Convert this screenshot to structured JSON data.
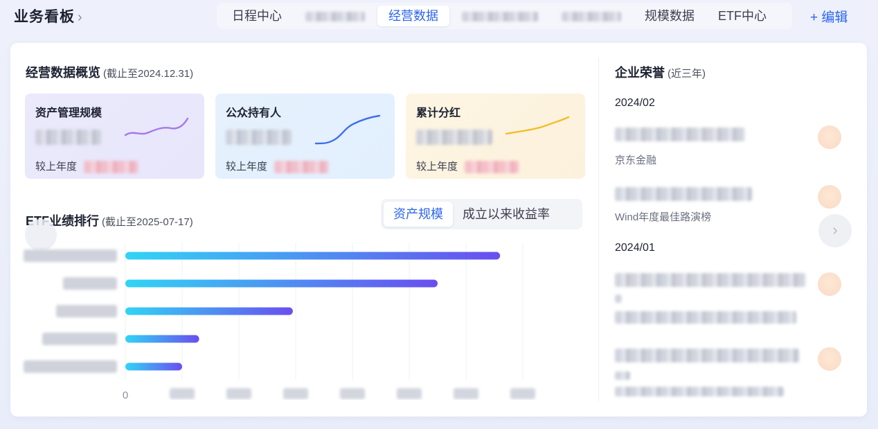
{
  "header": {
    "title": "业务看板",
    "title_chevron": "›",
    "tabs": [
      {
        "label": "日程中心",
        "active": false
      },
      {
        "label": "",
        "active": false
      },
      {
        "label": "经营数据",
        "active": true
      },
      {
        "label": "",
        "active": false
      },
      {
        "label": "",
        "active": false
      },
      {
        "label": "规模数据",
        "active": false
      },
      {
        "label": "ETF中心",
        "active": false
      }
    ],
    "edit_label": "+ 编辑"
  },
  "overview": {
    "title": "经营数据概览",
    "subtitle": "(截止至2024.12.31)",
    "cards": [
      {
        "label": "资产管理规模",
        "compare_label": "较上年度",
        "color": "#9b6fe6"
      },
      {
        "label": "公众持有人",
        "compare_label": "较上年度",
        "color": "#3f6fe8"
      },
      {
        "label": "累计分红",
        "compare_label": "较上年度",
        "color": "#f0bf2a"
      }
    ]
  },
  "etf_ranking": {
    "title": "ETF业绩排行",
    "subtitle": "(截止至2025-07-17)",
    "segments": [
      {
        "label": "资产规模",
        "active": true
      },
      {
        "label": "成立以来收益率",
        "active": false
      }
    ]
  },
  "chart_data": {
    "type": "bar",
    "orientation": "horizontal",
    "categories": [
      "",
      "",
      "",
      "",
      ""
    ],
    "values": [
      6.6,
      5.5,
      2.95,
      1.3,
      1.0
    ],
    "x_ticks": [
      "0",
      "",
      "",
      "",
      "",
      "",
      "",
      ""
    ],
    "xlim": [
      0,
      7
    ],
    "grid": true,
    "colors": {
      "start": "#31d4f5",
      "end": "#6a4ef0"
    }
  },
  "honors": {
    "title": "企业荣誉",
    "subtitle": "(近三年)",
    "groups": [
      {
        "year": "2024/02",
        "items": [
          {
            "source": "京东金融"
          },
          {
            "source": "Wind年度最佳路演榜"
          }
        ]
      },
      {
        "year": "2024/01",
        "items": [
          {
            "source": ""
          },
          {
            "source": ""
          }
        ]
      }
    ],
    "next_icon": "›"
  }
}
